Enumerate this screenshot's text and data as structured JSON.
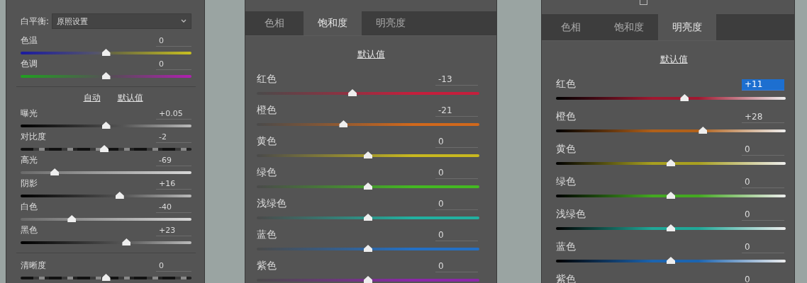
{
  "basic_panel": {
    "white_balance": {
      "label": "白平衡:",
      "value": "原照设置"
    },
    "color_sliders": [
      {
        "kind": "temperature",
        "label": "色温",
        "value": "0",
        "level": 0.5
      },
      {
        "kind": "tint",
        "label": "色调",
        "value": "0",
        "level": 0.5
      }
    ],
    "links": [
      "自动",
      "默认值"
    ],
    "tone_sliders": [
      {
        "kind": "tone",
        "label": "曝光",
        "value": "+0.05",
        "level": 0.5
      },
      {
        "kind": "texture",
        "label": "对比度",
        "value": "-2",
        "level": 0.49
      },
      {
        "kind": "highlight",
        "label": "高光",
        "value": "-69",
        "level": 0.2
      },
      {
        "kind": "tone",
        "label": "阴影",
        "value": "+16",
        "level": 0.58
      },
      {
        "kind": "highlight",
        "label": "白色",
        "value": "-40",
        "level": 0.3
      },
      {
        "kind": "tone",
        "label": "黑色",
        "value": "+23",
        "level": 0.62
      }
    ],
    "presence_sliders": [
      {
        "kind": "texture",
        "label": "清晰度",
        "value": "0",
        "level": 0.5
      }
    ]
  },
  "hsl_panels": [
    {
      "kind": "saturation",
      "tabs": [
        {
          "label": "色相",
          "selected": false
        },
        {
          "label": "饱和度",
          "selected": true
        },
        {
          "label": "明亮度",
          "selected": false
        }
      ],
      "reset_link": "默认值",
      "sliders": [
        {
          "label": "红色",
          "value": "-13",
          "level": 0.43,
          "color": "#c41f3c"
        },
        {
          "label": "橙色",
          "value": "-21",
          "level": 0.39,
          "color": "#d0681c"
        },
        {
          "label": "黄色",
          "value": "0",
          "level": 0.5,
          "color": "#c8b820"
        },
        {
          "label": "绿色",
          "value": "0",
          "level": 0.5,
          "color": "#44b822"
        },
        {
          "label": "浅绿色",
          "value": "0",
          "level": 0.5,
          "color": "#22b0a0"
        },
        {
          "label": "蓝色",
          "value": "0",
          "level": 0.5,
          "color": "#2470c4"
        },
        {
          "label": "紫色",
          "value": "0",
          "level": 0.5,
          "color": "#8a28a8"
        }
      ]
    },
    {
      "kind": "luminance",
      "checkbox": {
        "checked": false
      },
      "tabs": [
        {
          "label": "色相",
          "selected": false
        },
        {
          "label": "饱和度",
          "selected": false
        },
        {
          "label": "明亮度",
          "selected": true
        }
      ],
      "reset_link": "默认值",
      "sliders": [
        {
          "label": "红色",
          "value": "+11",
          "selected": true,
          "level": 0.56,
          "color": "#a01830"
        },
        {
          "label": "橙色",
          "value": "+28",
          "selected": false,
          "level": 0.64,
          "color": "#b0601a"
        },
        {
          "label": "黄色",
          "value": "0",
          "selected": false,
          "level": 0.5,
          "color": "#a8a020"
        },
        {
          "label": "绿色",
          "value": "0",
          "selected": false,
          "level": 0.5,
          "color": "#44a822"
        },
        {
          "label": "浅绿色",
          "value": "0",
          "selected": false,
          "level": 0.5,
          "color": "#20a898"
        },
        {
          "label": "蓝色",
          "value": "0",
          "selected": false,
          "level": 0.5,
          "color": "#1c64b0"
        },
        {
          "label": "紫色",
          "value": "0",
          "selected": false
        }
      ]
    }
  ]
}
